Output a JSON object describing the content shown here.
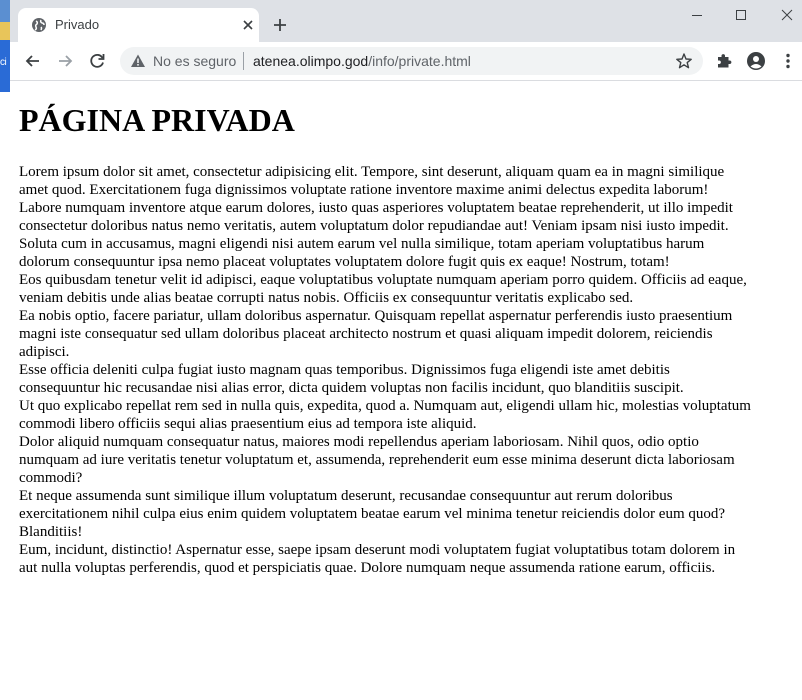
{
  "desktop": {
    "label_fragment": "ci"
  },
  "browser": {
    "tab": {
      "title": "Privado"
    },
    "toolbar": {
      "security_label": "No es seguro",
      "url_host": "atenea.olimpo.god",
      "url_path": "/info/private.html"
    }
  },
  "page": {
    "heading": "PÁGINA PRIVADA",
    "lines": [
      "Lorem ipsum dolor sit amet, consectetur adipisicing elit. Tempore, sint deserunt, aliquam quam ea in magni similique",
      "amet quod. Exercitationem fuga dignissimos voluptate ratione inventore maxime animi delectus expedita laborum!",
      "Labore numquam inventore atque earum dolores, iusto quas asperiores voluptatem beatae reprehenderit, ut illo impedit",
      "consectetur doloribus natus nemo veritatis, autem voluptatum dolor repudiandae aut! Veniam ipsam nisi iusto impedit.",
      "Soluta cum in accusamus, magni eligendi nisi autem earum vel nulla similique, totam aperiam voluptatibus harum",
      "dolorum consequuntur ipsa nemo placeat voluptates voluptatem dolore fugit quis ex eaque! Nostrum, totam!",
      "Eos quibusdam tenetur velit id adipisci, eaque voluptatibus voluptate numquam aperiam porro quidem. Officiis ad eaque,",
      "veniam debitis unde alias beatae corrupti natus nobis. Officiis ex consequuntur veritatis explicabo sed.",
      "Ea nobis optio, facere pariatur, ullam doloribus aspernatur. Quisquam repellat aspernatur perferendis iusto praesentium",
      "magni iste consequatur sed ullam doloribus placeat architecto nostrum et quasi aliquam impedit dolorem, reiciendis",
      "adipisci.",
      "Esse officia deleniti culpa fugiat iusto magnam quas temporibus. Dignissimos fuga eligendi iste amet debitis",
      "consequuntur hic recusandae nisi alias error, dicta quidem voluptas non facilis incidunt, quo blanditiis suscipit.",
      "Ut quo explicabo repellat rem sed in nulla quis, expedita, quod a. Numquam aut, eligendi ullam hic, molestias voluptatum",
      "commodi libero officiis sequi alias praesentium eius ad tempora iste aliquid.",
      "Dolor aliquid numquam consequatur natus, maiores modi repellendus aperiam laboriosam. Nihil quos, odio optio",
      "numquam ad iure veritatis tenetur voluptatum et, assumenda, reprehenderit eum esse minima deserunt dicta laboriosam",
      "commodi?",
      "Et neque assumenda sunt similique illum voluptatum deserunt, recusandae consequuntur aut rerum doloribus",
      "exercitationem nihil culpa eius enim quidem voluptatem beatae earum vel minima tenetur reiciendis dolor eum quod?",
      "Blanditiis!",
      "Eum, incidunt, distinctio! Aspernatur esse, saepe ipsam deserunt modi voluptatem fugiat voluptatibus totam dolorem in",
      "aut nulla voluptas perferendis, quod et perspiciatis quae. Dolore numquam neque assumenda ratione earum, officiis."
    ]
  },
  "colors": {
    "tab_strip_bg": "#dee1e6",
    "omnibox_bg": "#f1f3f4",
    "icon_gray": "#5f6368"
  },
  "icons": {
    "tab_favicon": "globe-icon",
    "tab_close": "close-icon",
    "new_tab": "plus-icon",
    "minimize": "minimize-icon",
    "maximize": "maximize-icon",
    "close_window": "close-icon",
    "back": "arrow-left-icon",
    "forward": "arrow-right-icon",
    "reload": "reload-icon",
    "security_warning": "warning-icon",
    "bookmark": "star-icon",
    "extensions": "puzzle-icon",
    "profile": "account-icon",
    "menu": "kebab-menu-icon"
  }
}
